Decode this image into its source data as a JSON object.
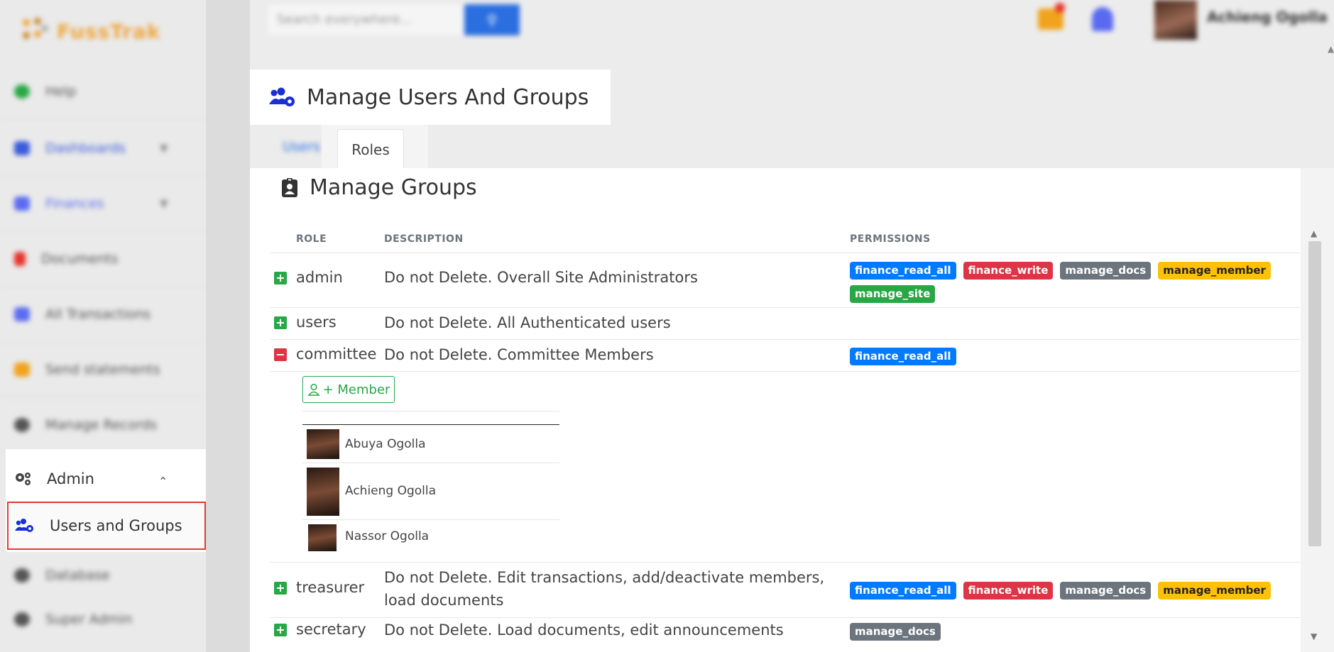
{
  "app": {
    "logo_text": "FussTrak"
  },
  "sidebar": {
    "items": [
      {
        "label": "Help",
        "icon": "help-icon",
        "color": "#28a745"
      },
      {
        "label": "Dashboards",
        "icon": "dashboard-icon",
        "color": "#3b5bdb"
      },
      {
        "label": "Finances",
        "icon": "finances-icon",
        "color": "#5b6cf0"
      },
      {
        "label": "Documents",
        "icon": "documents-icon",
        "color": "#e5332a"
      },
      {
        "label": "All Transactions",
        "icon": "transactions-icon",
        "color": "#5b6cf0"
      },
      {
        "label": "Send statements",
        "icon": "statements-icon",
        "color": "#f0a31d"
      },
      {
        "label": "Manage Records",
        "icon": "records-icon",
        "color": "#555555"
      }
    ],
    "admin": {
      "label": "Admin"
    },
    "users_groups": {
      "label": "Users and Groups"
    },
    "items_below": [
      {
        "label": "Database",
        "icon": "database-icon"
      },
      {
        "label": "Super Admin",
        "icon": "super-admin-icon"
      }
    ]
  },
  "topbar": {
    "search_placeholder": "Search everywhere...",
    "user_name": "Achieng Ogolla"
  },
  "page": {
    "title": "Manage Users And Groups"
  },
  "tabs": [
    {
      "label": "Users",
      "active": false
    },
    {
      "label": "Roles",
      "active": true
    }
  ],
  "card": {
    "title": "Manage Groups",
    "columns": {
      "role": "ROLE",
      "description": "DESCRIPTION",
      "permissions": "PERMISSIONS"
    },
    "rows": [
      {
        "role": "admin",
        "description": "Do not Delete. Overall Site Administrators",
        "expanded": false,
        "permissions": [
          "finance_read_all",
          "finance_write",
          "manage_docs",
          "manage_member",
          "manage_site"
        ]
      },
      {
        "role": "users",
        "description": "Do not Delete. All Authenticated users",
        "expanded": false,
        "permissions": []
      },
      {
        "role": "committee",
        "description": "Do not Delete. Committee Members",
        "expanded": true,
        "permissions": [
          "finance_read_all"
        ]
      },
      {
        "role": "treasurer",
        "description": "Do not Delete. Edit transactions, add/deactivate members, load documents",
        "expanded": false,
        "permissions": [
          "finance_read_all",
          "finance_write",
          "manage_docs",
          "manage_member"
        ]
      },
      {
        "role": "secretary",
        "description": "Do not Delete. Load documents, edit announcements",
        "expanded": false,
        "permissions": [
          "manage_docs"
        ]
      }
    ],
    "member_button": "+ Member",
    "members": [
      "Abuya Ogolla",
      "Achieng Ogolla",
      "Nassor Ogolla"
    ]
  },
  "permission_colors": {
    "finance_read_all": "#007bff",
    "finance_write": "#dc3545",
    "manage_docs": "#6c757d",
    "manage_member": "#ffc107",
    "manage_site": "#28a745"
  }
}
